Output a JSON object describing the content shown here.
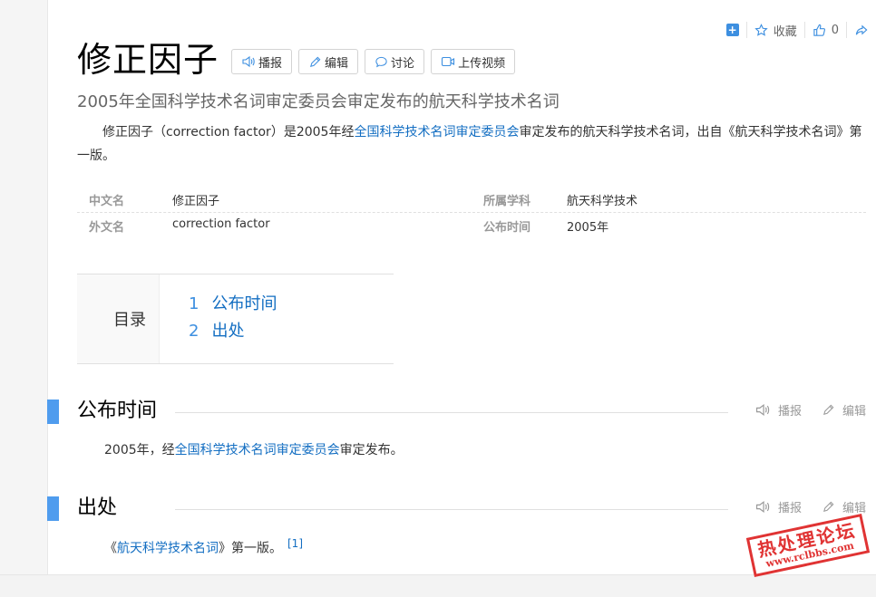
{
  "top_tools": {
    "collect_label": "收藏",
    "like_count": "0"
  },
  "lemma": {
    "title": "修正因子",
    "buttons": {
      "broadcast": "播报",
      "edit": "编辑",
      "discuss": "讨论",
      "upload_video": "上传视频"
    },
    "subtitle": "2005年全国科学技术名词审定委员会审定发布的航天科学技术名词",
    "intro": {
      "before": "修正因子（correction factor）是2005年经",
      "link": "全国科学技术名词审定委员会",
      "after": "审定发布的航天科学技术名词，出自《航天科学技术名词》第一版。"
    }
  },
  "basic_info": [
    {
      "left_key": "中文名",
      "left_value": "修正因子",
      "right_key": "所属学科",
      "right_value": "航天科学技术"
    },
    {
      "left_key": "外文名",
      "left_value": "correction factor",
      "right_key": "公布时间",
      "right_value": "2005年"
    }
  ],
  "toc": {
    "label": "目录",
    "items": [
      {
        "num": "1",
        "label": "公布时间"
      },
      {
        "num": "2",
        "label": "出处"
      }
    ]
  },
  "sections": [
    {
      "title": "公布时间",
      "actions": {
        "broadcast": "播报",
        "edit": "编辑"
      },
      "body": {
        "before": "2005年，经",
        "link": "全国科学技术名词审定委员会",
        "after": "审定发布。"
      }
    },
    {
      "title": "出处",
      "actions": {
        "broadcast": "播报",
        "edit": "编辑"
      },
      "body": {
        "before": "《",
        "link": "航天科学技术名词",
        "after": "》第一版。",
        "ref": "[1]"
      }
    }
  ],
  "watermark": {
    "title": "热处理论坛",
    "url": "www.rclbbs.com"
  },
  "colors": {
    "link": "#136ec2",
    "accent": "#4f9cee",
    "stamp": "#e03333"
  }
}
